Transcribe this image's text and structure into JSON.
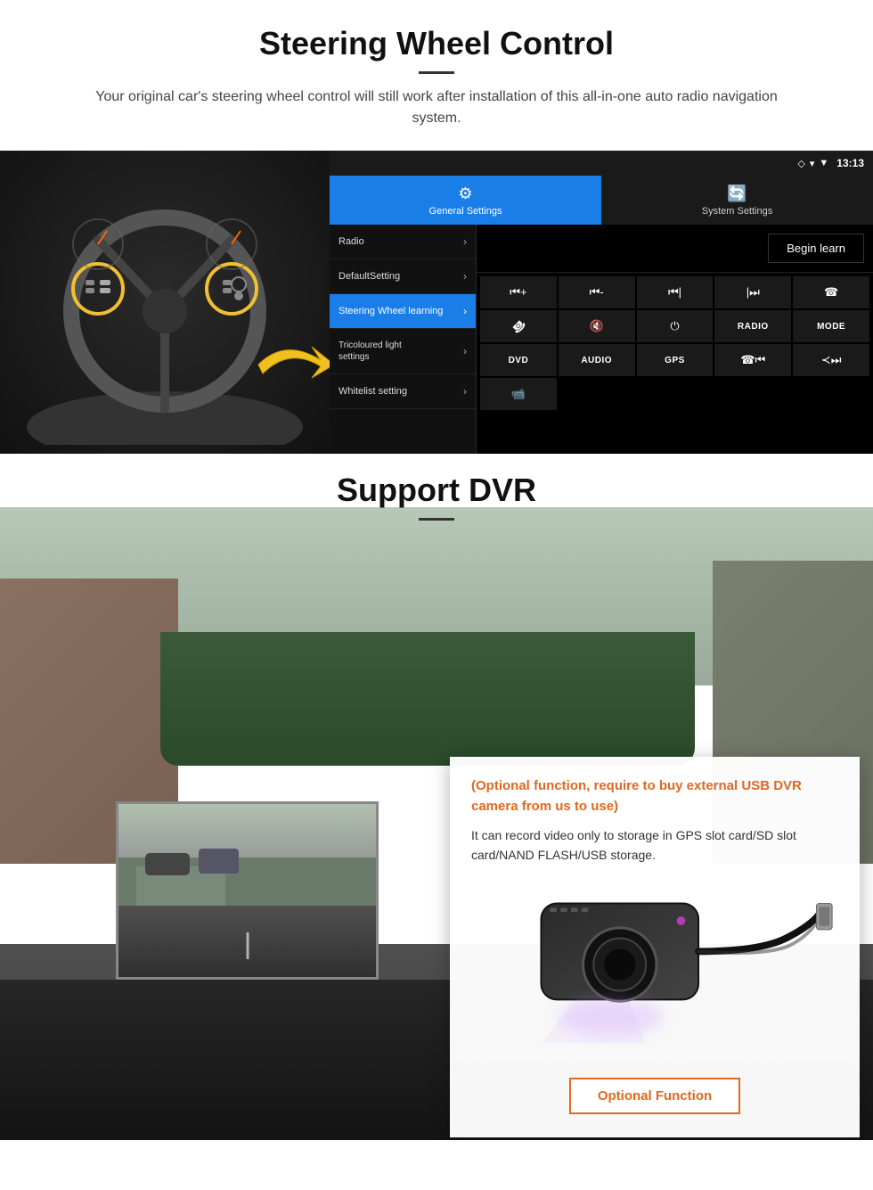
{
  "section1": {
    "title": "Steering Wheel Control",
    "subtitle": "Your original car's steering wheel control will still work after installation of this all-in-one auto radio navigation system.",
    "statusbar": {
      "time": "13:13",
      "signal_icon": "▼",
      "wifi_icon": "▾"
    },
    "tabs": [
      {
        "label": "General Settings",
        "icon": "⚙",
        "active": true
      },
      {
        "label": "System Settings",
        "icon": "🔄",
        "active": false
      }
    ],
    "menu": [
      {
        "label": "Radio",
        "active": false
      },
      {
        "label": "DefaultSetting",
        "active": false
      },
      {
        "label": "Steering Wheel learning",
        "active": true
      },
      {
        "label": "Tricoloured light settings",
        "active": false
      },
      {
        "label": "Whitelist setting",
        "active": false
      }
    ],
    "begin_learn_label": "Begin learn",
    "control_buttons": [
      "⏮+",
      "⏮-",
      "⏮|",
      "|⏭",
      "☎",
      "↩",
      "🔇×",
      "⏻",
      "RADIO",
      "MODE",
      "DVD",
      "AUDIO",
      "GPS",
      "☎⏮|",
      "≺⏭"
    ],
    "dvr_icon": "📹"
  },
  "section2": {
    "title": "Support DVR",
    "optional_text": "(Optional function, require to buy external USB DVR camera from us to use)",
    "description": "It can record video only to storage in GPS slot card/SD slot card/NAND FLASH/USB storage.",
    "optional_function_label": "Optional Function"
  }
}
